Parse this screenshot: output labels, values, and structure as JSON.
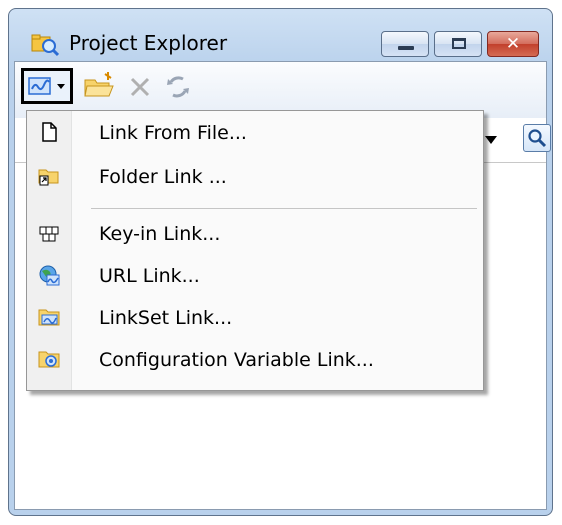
{
  "window": {
    "title": "Project Explorer",
    "close_glyph": "✕"
  },
  "toolbar": {
    "tools": [
      {
        "icon": "link-dropdown-icon"
      },
      {
        "icon": "open-folder-icon"
      },
      {
        "icon": "delete-icon"
      },
      {
        "icon": "refresh-icon"
      }
    ]
  },
  "menu": {
    "items": [
      {
        "label": "Link From File...",
        "icon": "file-icon"
      },
      {
        "label": "Folder Link ...",
        "icon": "folder-link-icon"
      },
      {
        "label": "Key-in Link...",
        "icon": "keyin-icon"
      },
      {
        "label": "URL Link...",
        "icon": "globe-link-icon"
      },
      {
        "label": "LinkSet Link...",
        "icon": "linkset-folder-icon"
      },
      {
        "label": "Configuration Variable Link...",
        "icon": "config-variable-folder-icon"
      }
    ]
  },
  "colors": {
    "title_gradient": "#b9d1ec",
    "close_button": "#c2402c",
    "link_icon_blue": "#2b6cd4"
  }
}
